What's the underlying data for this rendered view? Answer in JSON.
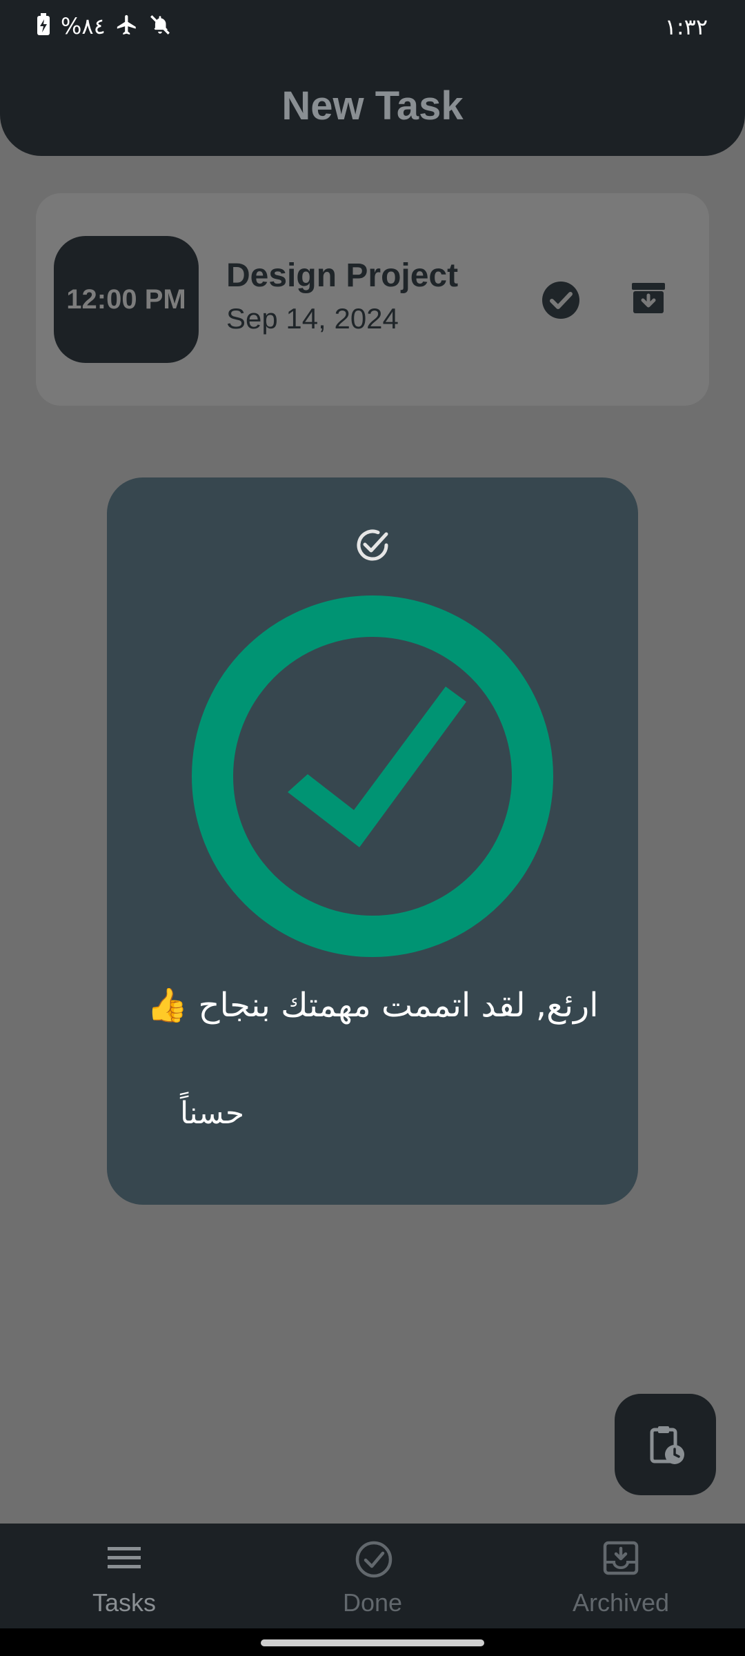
{
  "status_bar": {
    "battery_text": "%٨٤",
    "time": "١:٣٢",
    "icons": [
      "battery-charging-icon",
      "airplane-icon",
      "mute-icon"
    ]
  },
  "header": {
    "title": "New Task"
  },
  "task": {
    "time": "12:00 PM",
    "title": "Design Project",
    "date": "Sep 14, 2024",
    "actions": [
      "check-circle-icon",
      "archive-icon"
    ]
  },
  "dialog": {
    "icon_small": "check-circle-outline-icon",
    "icon_large": "check-circle-large-icon",
    "message": "ارئع, لقد اتممت مهمتك بنجاح 👍",
    "ok_label": "حسناً"
  },
  "fab": {
    "icon": "clipboard-clock-icon"
  },
  "bottom_nav": {
    "items": [
      {
        "label": "Tasks",
        "icon": "menu-icon"
      },
      {
        "label": "Done",
        "icon": "check-circle-outline-icon"
      },
      {
        "label": "Archived",
        "icon": "archive-icon"
      }
    ]
  },
  "colors": {
    "bar_bg": "#1c2125",
    "overlay_bg": "#6f6f6f",
    "dialog_bg": "#37474f",
    "success_green": "#009473"
  }
}
